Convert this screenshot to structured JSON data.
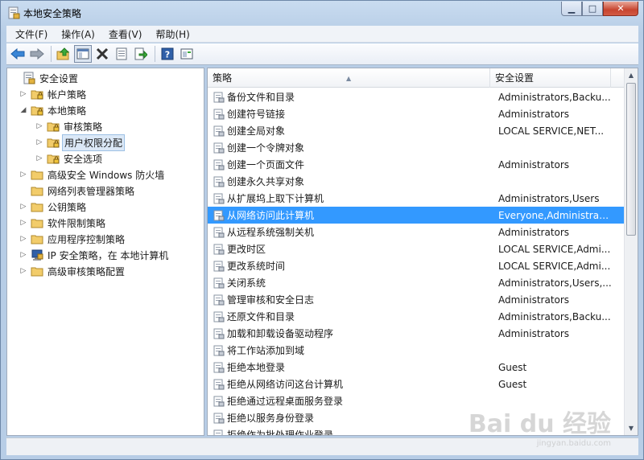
{
  "window": {
    "title": "本地安全策略",
    "controls": [
      "minimize",
      "maximize",
      "close"
    ]
  },
  "menu": [
    "文件(F)",
    "操作(A)",
    "查看(V)",
    "帮助(H)"
  ],
  "toolbar": [
    "back-icon",
    "forward-icon",
    "up-folder-icon",
    "show-tree-icon",
    "delete-icon",
    "properties-icon",
    "export-icon",
    "help-icon",
    "mmc-icon"
  ],
  "tree": [
    {
      "label": "安全设置",
      "depth": 0,
      "expander": "",
      "icon": "security-settings-icon"
    },
    {
      "label": "帐户策略",
      "depth": 1,
      "expander": "▷",
      "icon": "folder-lock-icon"
    },
    {
      "label": "本地策略",
      "depth": 1,
      "expander": "◢",
      "icon": "folder-lock-icon"
    },
    {
      "label": "审核策略",
      "depth": 2,
      "expander": "▷",
      "icon": "folder-lock-icon"
    },
    {
      "label": "用户权限分配",
      "depth": 2,
      "expander": "▷",
      "icon": "folder-lock-icon",
      "selected": true
    },
    {
      "label": "安全选项",
      "depth": 2,
      "expander": "▷",
      "icon": "folder-lock-icon"
    },
    {
      "label": "高级安全 Windows 防火墙",
      "depth": 1,
      "expander": "▷",
      "icon": "folder-icon"
    },
    {
      "label": "网络列表管理器策略",
      "depth": 1,
      "expander": "",
      "icon": "folder-icon"
    },
    {
      "label": "公钥策略",
      "depth": 1,
      "expander": "▷",
      "icon": "folder-icon"
    },
    {
      "label": "软件限制策略",
      "depth": 1,
      "expander": "▷",
      "icon": "folder-icon"
    },
    {
      "label": "应用程序控制策略",
      "depth": 1,
      "expander": "▷",
      "icon": "folder-icon"
    },
    {
      "label": "IP 安全策略，在 本地计算机",
      "depth": 1,
      "expander": "▷",
      "icon": "ip-security-icon"
    },
    {
      "label": "高级审核策略配置",
      "depth": 1,
      "expander": "▷",
      "icon": "folder-icon"
    }
  ],
  "list": {
    "columns": [
      "策略",
      "安全设置"
    ],
    "rows": [
      {
        "policy": "备份文件和目录",
        "setting": "Administrators,Backu..."
      },
      {
        "policy": "创建符号链接",
        "setting": "Administrators"
      },
      {
        "policy": "创建全局对象",
        "setting": "LOCAL SERVICE,NET..."
      },
      {
        "policy": "创建一个令牌对象",
        "setting": ""
      },
      {
        "policy": "创建一个页面文件",
        "setting": "Administrators"
      },
      {
        "policy": "创建永久共享对象",
        "setting": ""
      },
      {
        "policy": "从扩展坞上取下计算机",
        "setting": "Administrators,Users"
      },
      {
        "policy": "从网络访问此计算机",
        "setting": "Everyone,Administrat...",
        "selected": true
      },
      {
        "policy": "从远程系统强制关机",
        "setting": "Administrators"
      },
      {
        "policy": "更改时区",
        "setting": "LOCAL SERVICE,Admi..."
      },
      {
        "policy": "更改系统时间",
        "setting": "LOCAL SERVICE,Admi..."
      },
      {
        "policy": "关闭系统",
        "setting": "Administrators,Users,..."
      },
      {
        "policy": "管理审核和安全日志",
        "setting": "Administrators"
      },
      {
        "policy": "还原文件和目录",
        "setting": "Administrators,Backu..."
      },
      {
        "policy": "加载和卸载设备驱动程序",
        "setting": "Administrators"
      },
      {
        "policy": "将工作站添加到域",
        "setting": ""
      },
      {
        "policy": "拒绝本地登录",
        "setting": "Guest"
      },
      {
        "policy": "拒绝从网络访问这台计算机",
        "setting": "Guest"
      },
      {
        "policy": "拒绝通过远程桌面服务登录",
        "setting": ""
      },
      {
        "policy": "拒绝以服务身份登录",
        "setting": ""
      },
      {
        "policy": "拒绝作为批处理作业登录",
        "setting": ""
      }
    ]
  },
  "watermark": {
    "brand": "Bai du 经验",
    "url": "jingyan.baidu.com"
  },
  "colors": {
    "selection": "#3399ff",
    "tree_selection": "#dbe8f7",
    "frame": "#b7cde6"
  }
}
